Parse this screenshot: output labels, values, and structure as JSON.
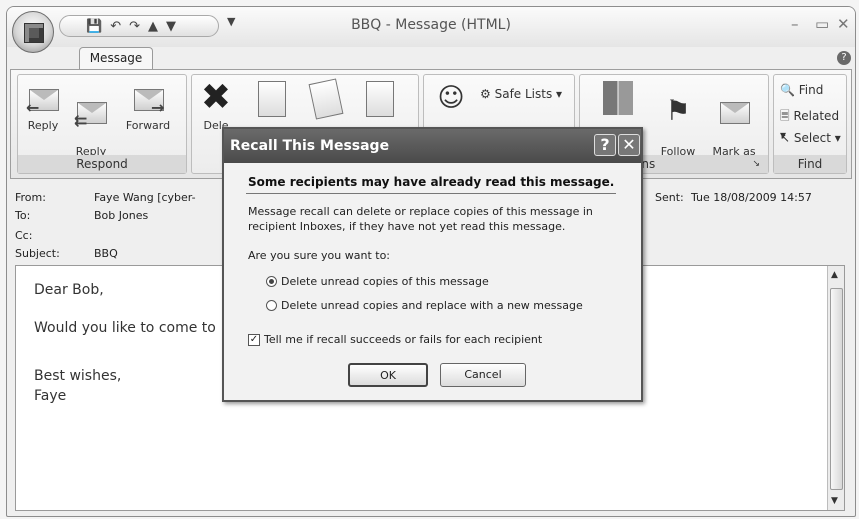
{
  "window": {
    "title": "BBQ - Message (HTML)"
  },
  "ribbon": {
    "tab": "Message",
    "respond": {
      "reply": "Reply",
      "reply_all": "Reply\nto All",
      "forward": "Forward",
      "label": "Respond"
    },
    "actions": {
      "delete_partial": "Dele"
    },
    "junk": {
      "safe_lists": "Safe Lists ▾"
    },
    "options": {
      "follow_up": "Follow\nUp ▾",
      "mark_unread": "Mark as\nUnread",
      "label_partial": "ons"
    },
    "find": {
      "find": "Find",
      "related": "Related ▾",
      "select": "Select ▾",
      "label": "Find"
    }
  },
  "header": {
    "from_label": "From:",
    "from_value": "Faye Wang [cyber-",
    "to_label": "To:",
    "to_value": "Bob Jones",
    "cc_label": "Cc:",
    "subject_label": "Subject:",
    "subject_value": "BBQ",
    "sent_label": "Sent:",
    "sent_value": "Tue 18/08/2009 14:57"
  },
  "message_body": {
    "line1": "Dear Bob,",
    "line2": "Would you like to come to",
    "line3": "Best wishes,",
    "line4": "Faye"
  },
  "dialog": {
    "title": "Recall This Message",
    "heading": "Some recipients may have already read this message.",
    "description": "Message recall can delete or replace copies of this message in recipient Inboxes, if they have not yet read this message.",
    "question": "Are you sure you want to:",
    "option_delete": "Delete unread copies of this message",
    "option_replace": "Delete unread copies and replace with a new message",
    "selected_option": "option_delete",
    "tell_me": "Tell me if recall succeeds or fails for each recipient",
    "tell_me_checked": true,
    "ok": "OK",
    "cancel": "Cancel"
  }
}
